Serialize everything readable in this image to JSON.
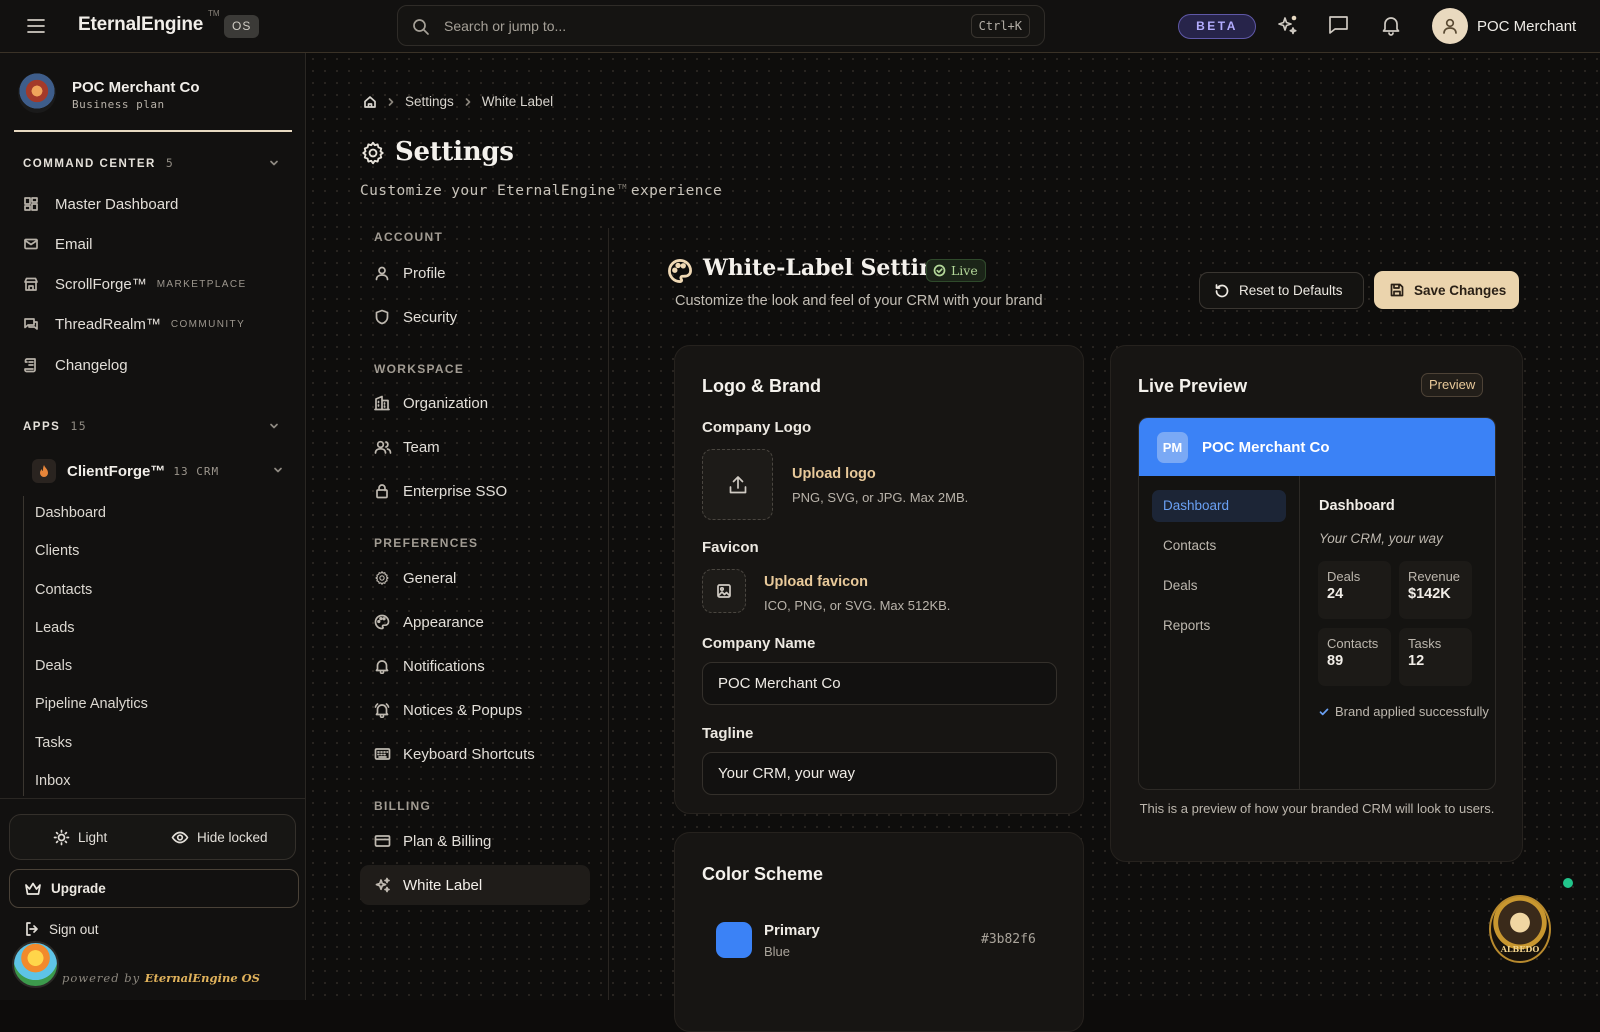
{
  "topbar": {
    "brand": "EternalEngine",
    "trademark": "TM",
    "os_badge": "OS",
    "search_placeholder": "Search or jump to...",
    "search_shortcut": "Ctrl+K",
    "beta_badge": "BETA",
    "user_name": "POC Merchant",
    "icons": [
      "menu-icon",
      "search-icon",
      "sparkle-icon",
      "chat-icon",
      "bell-icon",
      "user-icon"
    ]
  },
  "sidebar": {
    "org_name": "POC Merchant Co",
    "org_plan": "Business plan",
    "command_center": {
      "title": "COMMAND CENTER",
      "count": "5"
    },
    "command_items": [
      {
        "label": "Master Dashboard",
        "tag": "",
        "icon": "grid-icon"
      },
      {
        "label": "Email",
        "tag": "",
        "icon": "mail-icon"
      },
      {
        "label": "ScrollForge™",
        "tag": "MARKETPLACE",
        "icon": "store-icon"
      },
      {
        "label": "ThreadRealm™",
        "tag": "COMMUNITY",
        "icon": "messages-icon"
      },
      {
        "label": "Changelog",
        "tag": "",
        "icon": "scroll-icon"
      }
    ],
    "apps": {
      "title": "APPS",
      "count": "15"
    },
    "clientforge": {
      "label": "ClientForge™",
      "count": "13",
      "tag": "CRM"
    },
    "clientforge_items": [
      "Dashboard",
      "Clients",
      "Contacts",
      "Leads",
      "Deals",
      "Pipeline Analytics",
      "Tasks",
      "Inbox"
    ],
    "mode_light": "Light",
    "mode_hide_locked": "Hide locked",
    "upgrade": "Upgrade",
    "sign_out": "Sign out",
    "powered_prefix": "powered by",
    "powered_brand": "EternalEngine OS"
  },
  "breadcrumb": [
    "Settings",
    "White Label"
  ],
  "page": {
    "title": "Settings",
    "subtitle_pre": "Customize your EternalEngine",
    "subtitle_tm": "TM",
    "subtitle_post": "experience"
  },
  "settings_nav": {
    "sections": [
      {
        "heading": "ACCOUNT",
        "items": [
          {
            "label": "Profile",
            "icon": "user-icon"
          },
          {
            "label": "Security",
            "icon": "shield-icon"
          }
        ]
      },
      {
        "heading": "WORKSPACE",
        "items": [
          {
            "label": "Organization",
            "icon": "building-icon"
          },
          {
            "label": "Team",
            "icon": "users-icon"
          },
          {
            "label": "Enterprise SSO",
            "icon": "lock-icon"
          }
        ]
      },
      {
        "heading": "PREFERENCES",
        "items": [
          {
            "label": "General",
            "icon": "gear-icon"
          },
          {
            "label": "Appearance",
            "icon": "palette-icon"
          },
          {
            "label": "Notifications",
            "icon": "bell-icon"
          },
          {
            "label": "Notices & Popups",
            "icon": "bell-ring-icon"
          },
          {
            "label": "Keyboard Shortcuts",
            "icon": "keyboard-icon"
          }
        ]
      },
      {
        "heading": "BILLING",
        "items": [
          {
            "label": "Plan & Billing",
            "icon": "card-icon"
          },
          {
            "label": "White Label",
            "icon": "sparkles-icon",
            "active": true
          }
        ]
      }
    ]
  },
  "white_label": {
    "title": "White-Label Settings",
    "live_badge": "Live",
    "subtitle": "Customize the look and feel of your CRM with your brand",
    "reset_button": "Reset to Defaults",
    "save_button": "Save Changes"
  },
  "logo_brand": {
    "title": "Logo & Brand",
    "company_logo_label": "Company Logo",
    "upload_logo": "Upload logo",
    "upload_logo_hint": "PNG, SVG, or JPG. Max 2MB.",
    "favicon_label": "Favicon",
    "upload_favicon": "Upload favicon",
    "upload_favicon_hint": "ICO, PNG, or SVG. Max 512KB.",
    "company_name_label": "Company Name",
    "company_name_value": "POC Merchant Co",
    "tagline_label": "Tagline",
    "tagline_value": "Your CRM, your way"
  },
  "color_scheme": {
    "title": "Color Scheme",
    "primary_label": "Primary",
    "primary_name": "Blue",
    "primary_hex": "#3b82f6"
  },
  "preview": {
    "title": "Live Preview",
    "badge": "Preview",
    "initials": "PM",
    "company": "POC Merchant Co",
    "nav": [
      "Dashboard",
      "Contacts",
      "Deals",
      "Reports"
    ],
    "main_title": "Dashboard",
    "main_subtitle": "Your CRM, your way",
    "stats": [
      {
        "label": "Deals",
        "value": "24"
      },
      {
        "label": "Revenue",
        "value": "$142K"
      },
      {
        "label": "Contacts",
        "value": "89"
      },
      {
        "label": "Tasks",
        "value": "12"
      }
    ],
    "status": "Brand applied successfully",
    "note": "This is a preview of how your branded CRM will look to users."
  },
  "assistant": {
    "label": "ALBEDO"
  },
  "colors": {
    "accent": "#ebd4ad",
    "primary": "#3b82f6",
    "online": "#22c58b"
  }
}
